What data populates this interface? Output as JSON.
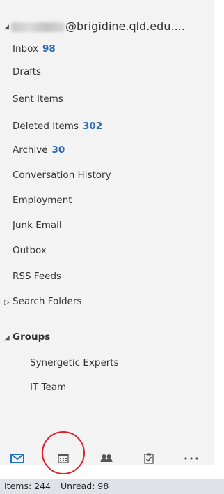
{
  "account": {
    "email_suffix": "@brigidine.qld.edu...."
  },
  "folders": [
    {
      "label": "Inbox",
      "count": "98"
    },
    {
      "label": "Drafts",
      "count": ""
    },
    {
      "label": "Sent Items",
      "count": ""
    },
    {
      "label": "Deleted Items",
      "count": "302"
    },
    {
      "label": "Archive",
      "count": "30"
    },
    {
      "label": "Conversation History",
      "count": ""
    },
    {
      "label": "Employment",
      "count": ""
    },
    {
      "label": "Junk Email",
      "count": ""
    },
    {
      "label": "Outbox",
      "count": ""
    },
    {
      "label": "RSS Feeds",
      "count": ""
    }
  ],
  "search_folders": {
    "label": "Search Folders"
  },
  "groups": {
    "label": "Groups",
    "items": [
      "Synergetic Experts",
      "IT Team"
    ]
  },
  "nav": {
    "icons": [
      "mail-icon",
      "calendar-icon",
      "people-icon",
      "tasks-icon",
      "more-icon"
    ],
    "accent": "#1a73c8",
    "highlight": "#e01f26"
  },
  "status": {
    "items": "Items: 244",
    "unread": "Unread: 98"
  }
}
